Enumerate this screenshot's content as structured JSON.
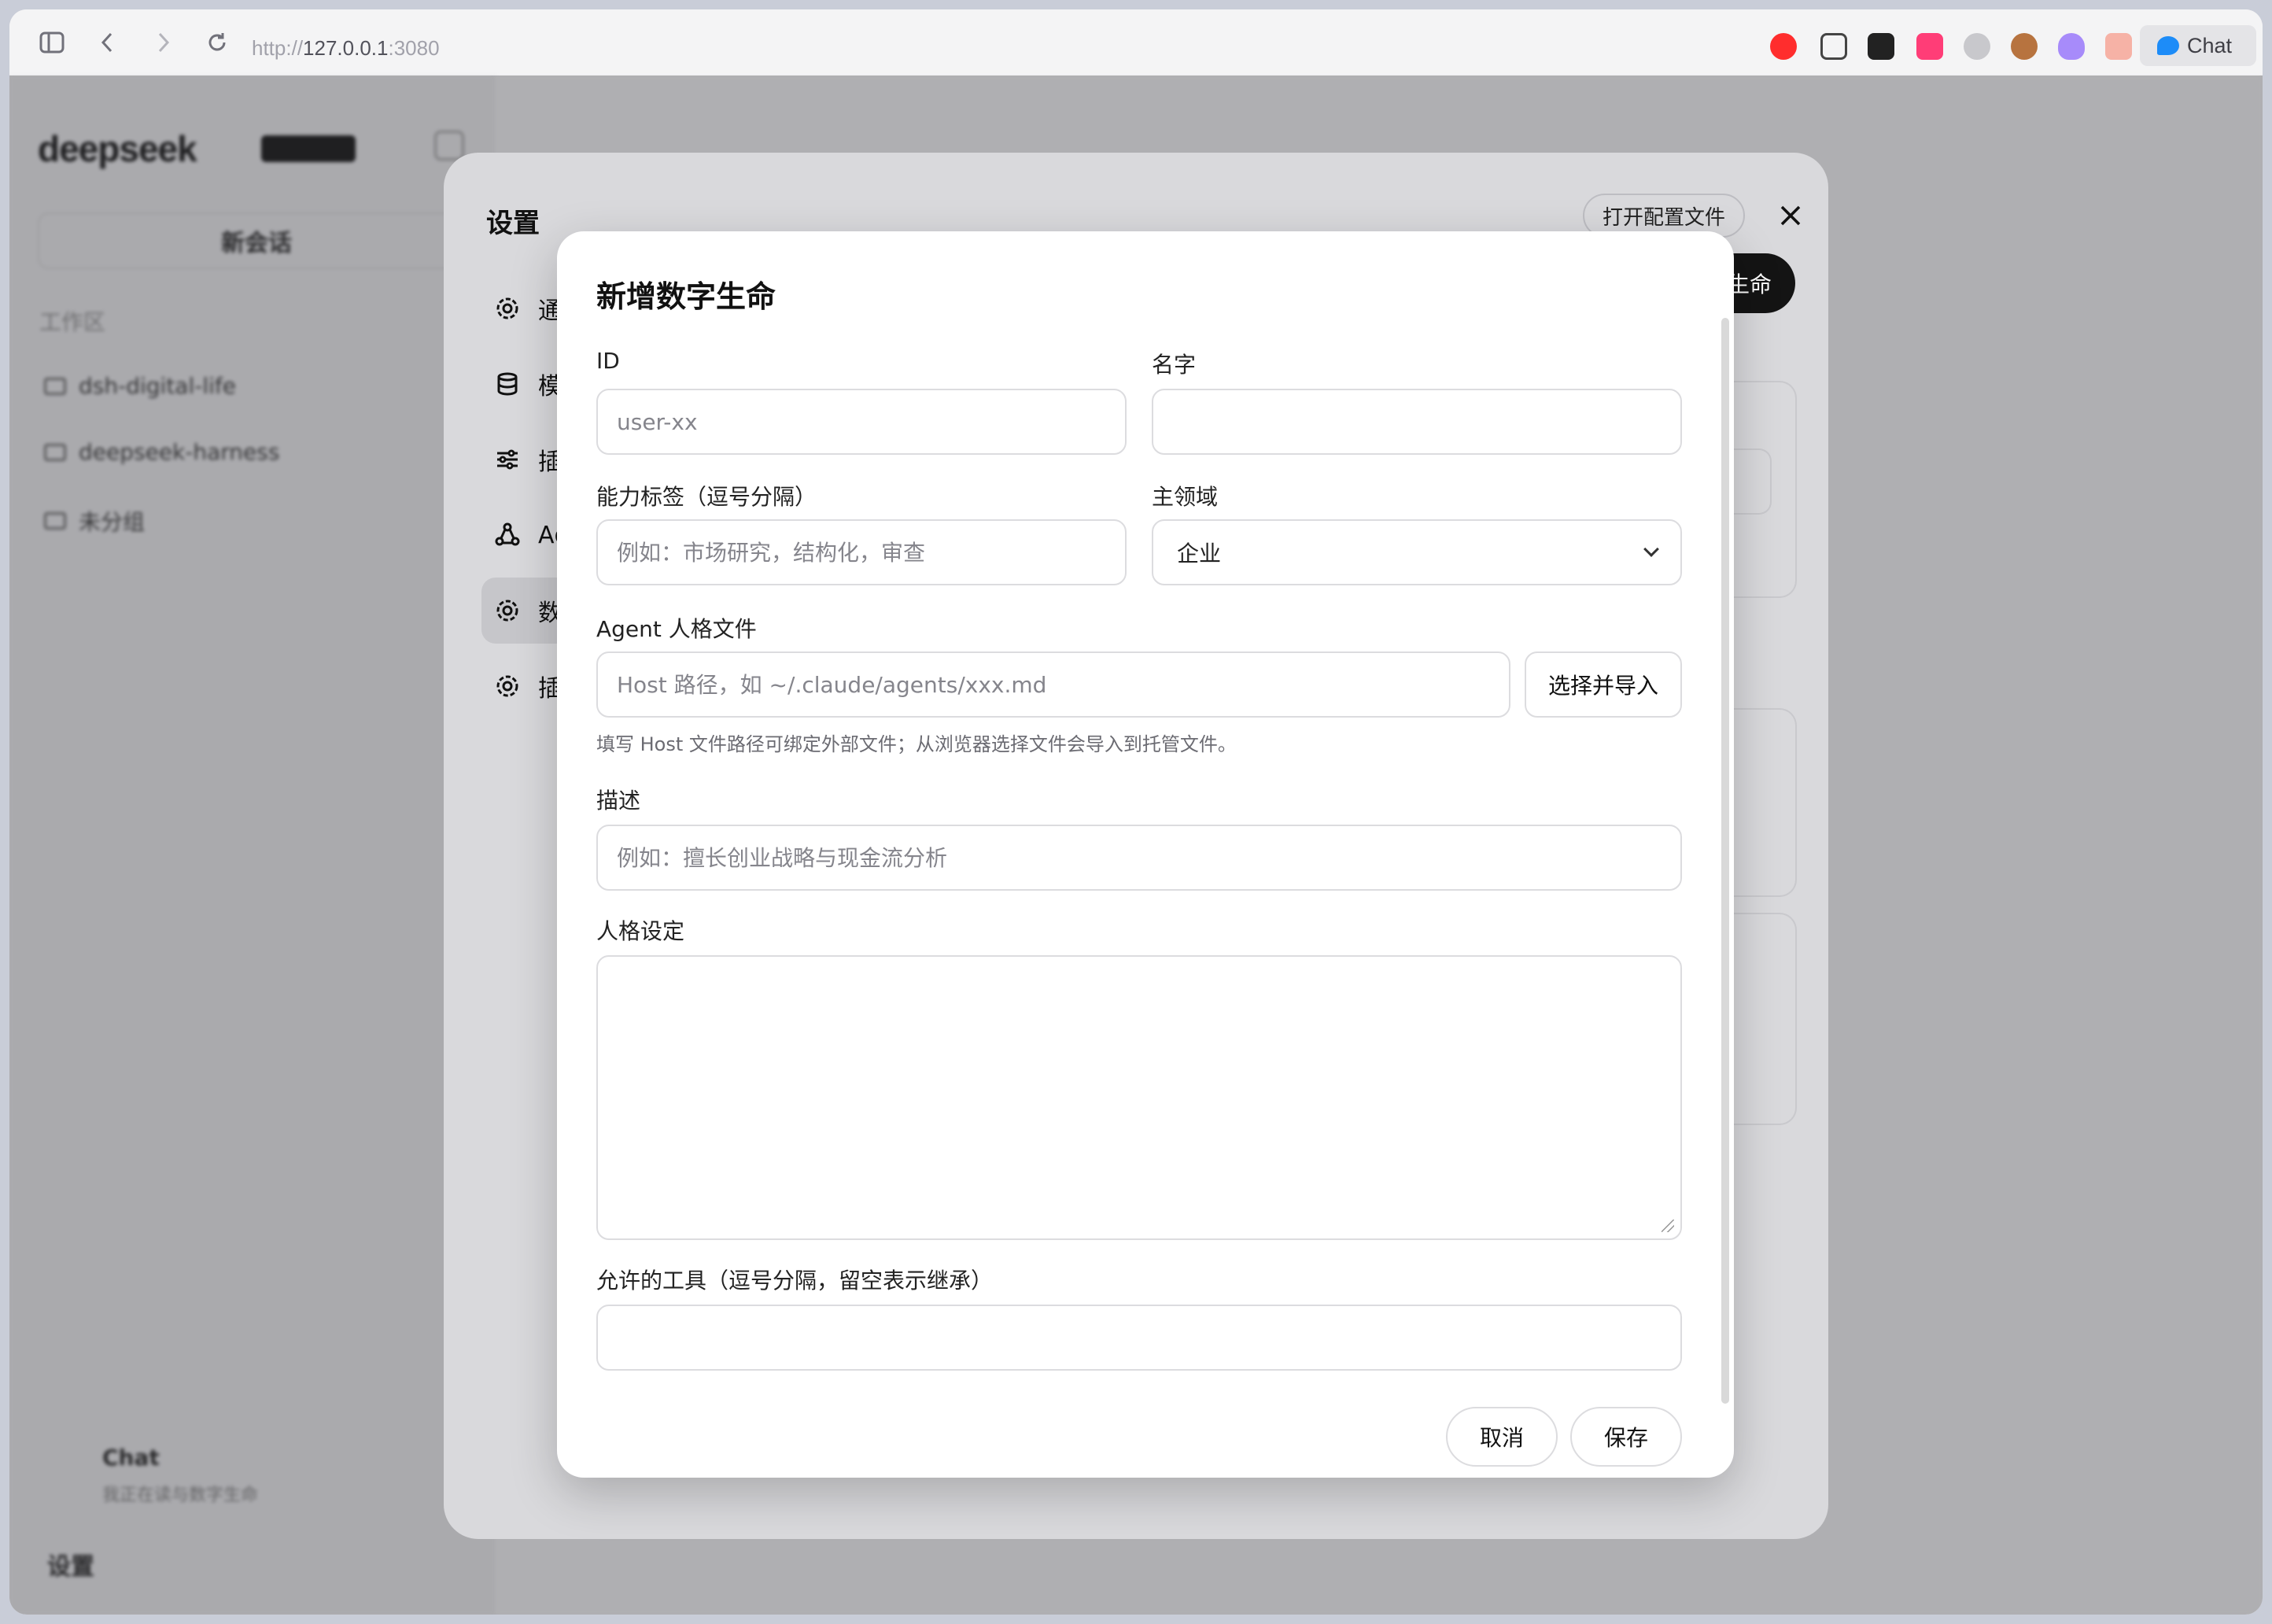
{
  "browser": {
    "url_scheme": "http://",
    "url_host": "127.0.0.1",
    "url_port": ":3080",
    "chat_label": "Chat"
  },
  "sidebar": {
    "logo": "deepseek",
    "new_chat": "新会话",
    "workspace_label": "工作区",
    "items": [
      "dsh-digital-life",
      "deepseek-harness",
      "未分组"
    ],
    "footer_title": "Chat",
    "footer_subtitle": "我正在读与数字生命",
    "settings_label": "设置"
  },
  "settings": {
    "title": "设置",
    "open_config": "打开配置文件",
    "new_life_partial": "生命",
    "nav": [
      "通",
      "模",
      "插",
      "Ag",
      "数",
      "插"
    ]
  },
  "modal": {
    "title": "新增数字生命",
    "id_label": "ID",
    "id_placeholder": "user-xx",
    "name_label": "名字",
    "name_placeholder": "",
    "tags_label": "能力标签（逗号分隔）",
    "tags_placeholder": "例如：市场研究，结构化，审查",
    "domain_label": "主领域",
    "domain_value": "企业",
    "persona_file_label": "Agent 人格文件",
    "persona_file_placeholder": "Host 路径，如 ~/.claude/agents/xxx.md",
    "import_button": "选择并导入",
    "persona_file_hint": "填写 Host 文件路径可绑定外部文件；从浏览器选择文件会导入到托管文件。",
    "desc_label": "描述",
    "desc_placeholder": "例如：擅长创业战略与现金流分析",
    "persona_label": "人格设定",
    "tools_label": "允许的工具（逗号分隔，留空表示继承）",
    "tools_placeholder": "",
    "cancel": "取消",
    "save": "保存"
  },
  "colors": {
    "primary_dark": "#141414",
    "chat_accent": "#1d8cf8"
  }
}
